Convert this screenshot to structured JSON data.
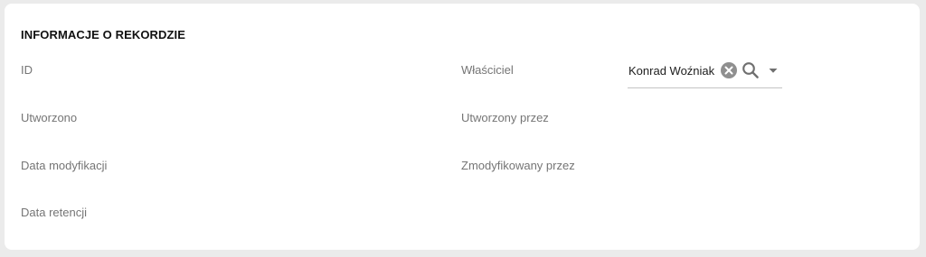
{
  "section": {
    "title": "INFORMACJE O REKORDZIE"
  },
  "fields": {
    "id_label": "ID",
    "created_label": "Utworzono",
    "modified_date_label": "Data modyfikacji",
    "retention_date_label": "Data retencji",
    "owner_label": "Właściciel",
    "created_by_label": "Utworzony przez",
    "modified_by_label": "Zmodyfikowany przez"
  },
  "owner": {
    "value": "Konrad Woźniak",
    "icons": [
      "clear-icon",
      "search-icon",
      "dropdown-arrow-icon"
    ]
  },
  "colors": {
    "background": "#ebebeb",
    "card": "#ffffff",
    "label": "#757575",
    "title": "#111111",
    "icon": "#7a7a7a"
  }
}
